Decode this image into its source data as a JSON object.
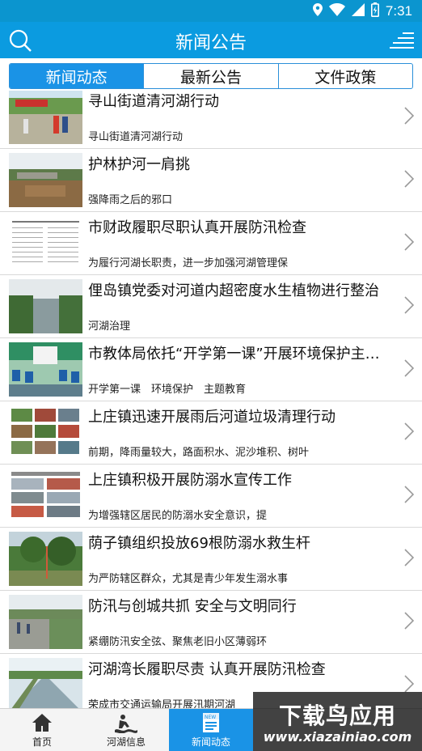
{
  "status_bar": {
    "time": "7:31"
  },
  "app_bar": {
    "title": "新闻公告"
  },
  "tabs": [
    {
      "label": "新闻动态",
      "active": true
    },
    {
      "label": "最新公告",
      "active": false
    },
    {
      "label": "文件政策",
      "active": false
    }
  ],
  "news": [
    {
      "title": "寻山街道清河湖行动",
      "desc": "寻山街道清河湖行动"
    },
    {
      "title": "护林护河一肩挑",
      "desc": "强降雨之后的邪口"
    },
    {
      "title": "市财政履职尽职认真开展防汛检查",
      "desc": "为履行河湖长职责，进一步加强河湖管理保"
    },
    {
      "title": "俚岛镇党委对河道内超密度水生植物进行整治",
      "desc": "河湖治理"
    },
    {
      "title": "市教体局依托“开学第一课”开展环境保护主…",
      "desc": "开学第一课　环境保护　主题教育"
    },
    {
      "title": "上庄镇迅速开展雨后河道垃圾清理行动",
      "desc": "前期，降雨量较大，路面积水、泥沙堆积、树叶"
    },
    {
      "title": "上庄镇积极开展防溺水宣传工作",
      "desc": "为增强辖区居民的防溺水安全意识，提"
    },
    {
      "title": "荫子镇组织投放69根防溺水救生杆",
      "desc": "为严防辖区群众，尤其是青少年发生溺水事"
    },
    {
      "title": "防汛与创城共抓 安全与文明同行",
      "desc": "紧绷防汛安全弦、聚焦老旧小区薄弱环"
    },
    {
      "title": "河湖湾长履职尽责 认真开展防汛检查",
      "desc": "荣成市交通运输局开展汛期河湖"
    }
  ],
  "bottom_nav": [
    {
      "label": "首页",
      "icon": "home-icon"
    },
    {
      "label": "河湖信息",
      "icon": "river-info-icon"
    },
    {
      "label": "新闻动态",
      "icon": "news-icon",
      "active": true
    }
  ],
  "watermark": {
    "title": "下载鸟应用",
    "url": "www.xiazainiao.com"
  },
  "colors": {
    "primary": "#0b9be0",
    "tab_active": "#1a93e6"
  }
}
